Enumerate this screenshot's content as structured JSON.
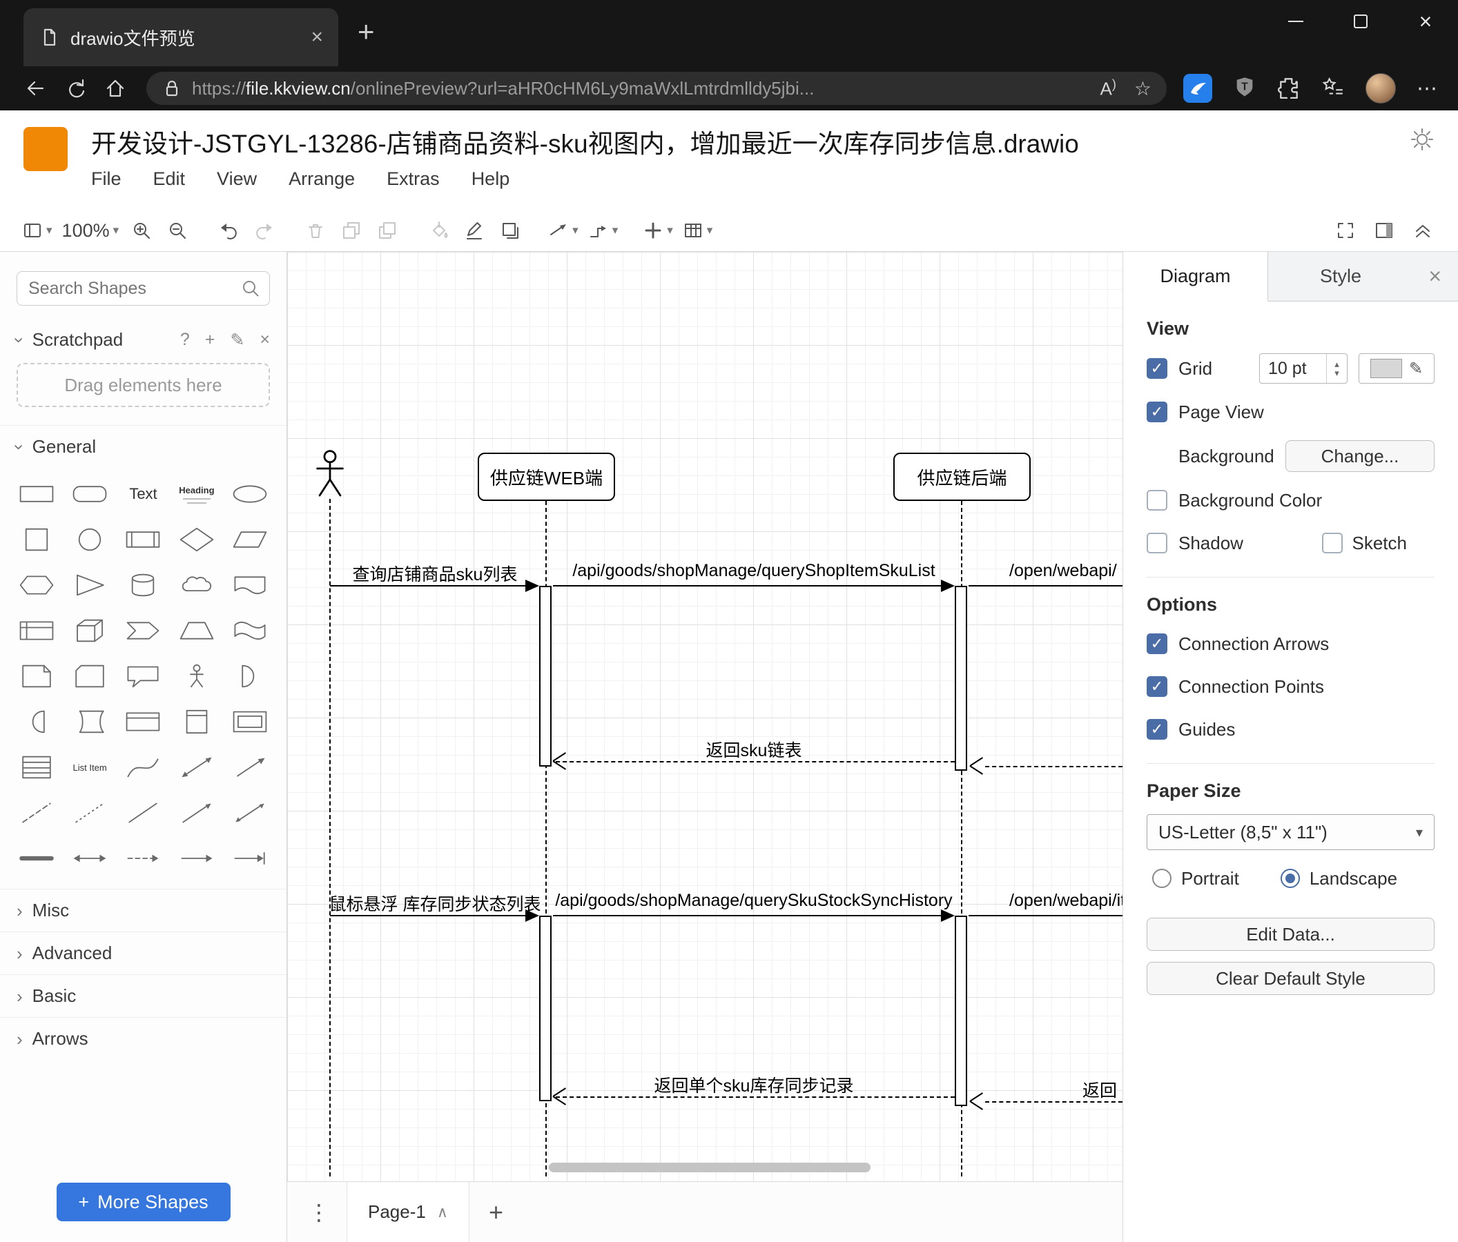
{
  "icons": {
    "check": "✓",
    "chevron": "›",
    "caret_down": "▾",
    "caret_up_small": "▴",
    "close": "×",
    "plus": "+",
    "more_horizontal": "⋯",
    "more_vertical": "⋮",
    "star": "☆",
    "help": "?",
    "pencil": "✎",
    "page_chevron": "∧",
    "read_aloud_a": "A",
    "read_aloud_paren": ")",
    "shield_letter": "T"
  },
  "browser": {
    "tab_title": "drawio文件预览",
    "url": {
      "scheme": "https://",
      "domain": "file.kkview.cn",
      "path": "/onlinePreview?url=aHR0cHM6Ly9maWxlLmtrdmlldy5jbi..."
    }
  },
  "drawio": {
    "file_title": "开发设计-JSTGYL-13286-店铺商品资料-sku视图内，增加最近一次库存同步信息.drawio",
    "menus": [
      "File",
      "Edit",
      "View",
      "Arrange",
      "Extras",
      "Help"
    ],
    "zoom": "100%"
  },
  "sidebar": {
    "search_placeholder": "Search Shapes",
    "scratchpad_label": "Scratchpad",
    "drag_hint": "Drag elements here",
    "sections": {
      "general": "General",
      "misc": "Misc",
      "advanced": "Advanced",
      "basic": "Basic",
      "arrows": "Arrows"
    },
    "shape_labels": {
      "text": "Text",
      "heading": "Heading",
      "list_item": "List Item"
    },
    "more_shapes": "More Shapes"
  },
  "canvas": {
    "page_tab": "Page-1",
    "diagram": {
      "web_label": "供应链WEB端",
      "backend_label": "供应链后端",
      "messages": {
        "m1": "查询店铺商品sku列表",
        "m2": "/api/goods/shopManage/queryShopItemSkuList",
        "m3": "/open/webapi/",
        "r1": "返回sku链表",
        "m4": "鼠标悬浮 库存同步状态列表",
        "m5": "/api/goods/shopManage/querySkuStockSyncHistory",
        "m6": "/open/webapi/item",
        "r2": "返回单个sku库存同步记录",
        "r3": "返回"
      }
    }
  },
  "format_panel": {
    "tab_diagram": "Diagram",
    "tab_style": "Style",
    "view_heading": "View",
    "grid_label": "Grid",
    "grid_size": "10 pt",
    "page_view_label": "Page View",
    "background_label": "Background",
    "change_button": "Change...",
    "background_color_label": "Background Color",
    "shadow_label": "Shadow",
    "sketch_label": "Sketch",
    "options_heading": "Options",
    "connection_arrows_label": "Connection Arrows",
    "connection_points_label": "Connection Points",
    "guides_label": "Guides",
    "paper_heading": "Paper Size",
    "paper_value": "US-Letter (8,5\" x 11\")",
    "portrait_label": "Portrait",
    "landscape_label": "Landscape",
    "edit_data_button": "Edit Data...",
    "clear_style_button": "Clear Default Style"
  }
}
